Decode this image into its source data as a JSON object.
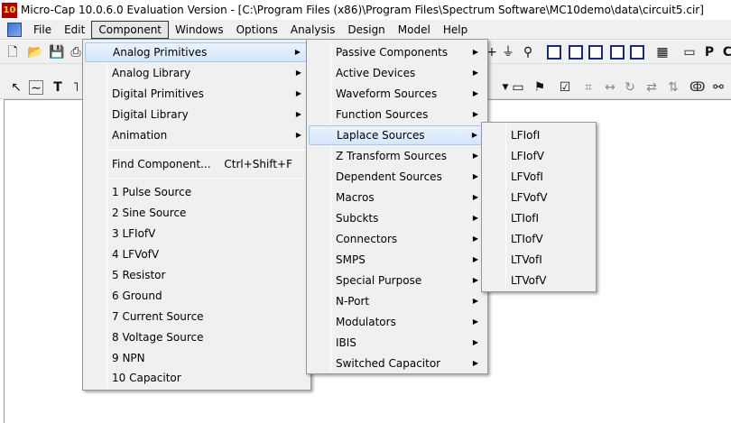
{
  "window": {
    "logo_text": "10",
    "title": "Micro-Cap 10.0.6.0 Evaluation Version - [C:\\Program Files (x86)\\Program Files\\Spectrum Software\\MC10demo\\data\\circuit5.cir]"
  },
  "menubar": {
    "items": [
      "File",
      "Edit",
      "Component",
      "Windows",
      "Options",
      "Analysis",
      "Design",
      "Model",
      "Help"
    ]
  },
  "component_menu": {
    "analog_primitives": "Analog Primitives",
    "analog_library": "Analog Library",
    "digital_primitives": "Digital Primitives",
    "digital_library": "Digital Library",
    "animation": "Animation",
    "find_component": "Find Component...",
    "find_shortcut": "Ctrl+Shift+F",
    "recent": [
      "1 Pulse Source",
      "2 Sine Source",
      "3 LFIofV",
      "4 LFVofV",
      "5 Resistor",
      "6 Ground",
      "7 Current Source",
      "8 Voltage Source",
      "9 NPN",
      "10 Capacitor"
    ]
  },
  "analog_menu": {
    "items": [
      "Passive Components",
      "Active Devices",
      "Waveform Sources",
      "Function Sources",
      "Laplace Sources",
      "Z Transform Sources",
      "Dependent Sources",
      "Macros",
      "Subckts",
      "Connectors",
      "SMPS",
      "Special Purpose",
      "N-Port",
      "Modulators",
      "IBIS",
      "Switched Capacitor"
    ]
  },
  "laplace_menu": {
    "items": [
      "LFIofI",
      "LFIofV",
      "LFVofI",
      "LFVofV",
      "LTIofI",
      "LTIofV",
      "LTVofI",
      "LTVofV"
    ]
  },
  "arrow_glyph": "▶"
}
